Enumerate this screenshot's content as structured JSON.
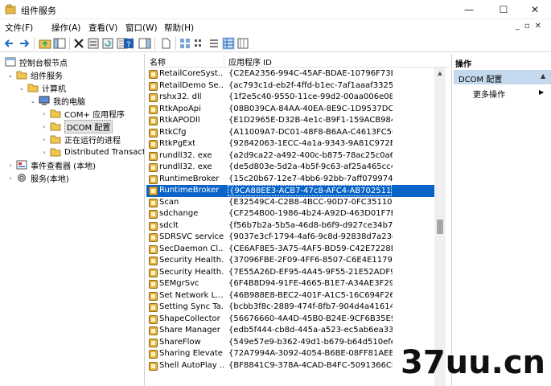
{
  "window": {
    "title": "组件服务"
  },
  "menu": [
    "文件(F)",
    "操作(A)",
    "查看(V)",
    "窗口(W)",
    "帮助(H)"
  ],
  "tree": {
    "items": [
      {
        "label": "控制台根节点",
        "expander": "",
        "icon": "console-root-icon"
      },
      {
        "label": "组件服务",
        "expander": "⌄",
        "icon": "folder-icon"
      },
      {
        "label": "计算机",
        "expander": "⌄",
        "icon": "folder-icon"
      },
      {
        "label": "我的电脑",
        "expander": "⌄",
        "icon": "computer-icon"
      },
      {
        "label": "COM+ 应用程序",
        "expander": "›",
        "icon": "folder-icon"
      },
      {
        "label": "DCOM 配置",
        "expander": "›",
        "icon": "folder-icon",
        "selected": true
      },
      {
        "label": "正在运行的进程",
        "expander": "›",
        "icon": "folder-icon"
      },
      {
        "label": "Distributed Transact",
        "expander": "›",
        "icon": "folder-icon"
      },
      {
        "label": "事件查看器 (本地)",
        "expander": "›",
        "icon": "event-viewer-icon"
      },
      {
        "label": "服务(本地)",
        "expander": "›",
        "icon": "services-icon"
      }
    ]
  },
  "list": {
    "columns": [
      "名称",
      "应用程序 ID"
    ],
    "rows": [
      {
        "name": "RetailCoreSyst...",
        "id": "{C2EA2356-994C-45AF-BDAE-10796F73B..."
      },
      {
        "name": "RetailDemo Se...",
        "id": "{ac793c1d-eb2f-4ffd-b1ec-7af1aaaf3325}"
      },
      {
        "name": "rshx32. dll",
        "id": "{1f2e5c40-9550-11ce-99d2-00aa006e086c}"
      },
      {
        "name": "RtkApoApi",
        "id": "{08B039CA-84AA-40EA-8E9C-1D9537DC4..."
      },
      {
        "name": "RtkAPODll",
        "id": "{E1D2965E-D32B-4e1c-B9F1-159ACB984..."
      },
      {
        "name": "RtkCfg",
        "id": "{A11009A7-DC01-48F8-B6AA-C4613FC5C..."
      },
      {
        "name": "RtkPgExt",
        "id": "{92842063-1ECC-4a1a-9343-9A81C972E..."
      },
      {
        "name": "rundll32. exe",
        "id": "{a2d9ca22-a492-400c-b875-78ac25c0a6f3}"
      },
      {
        "name": "rundll32. exe",
        "id": "{de5d803e-5d2a-4b5f-9c63-af25a465cc44}"
      },
      {
        "name": "RuntimeBroker",
        "id": "{15c20b67-12e7-4bb6-92bb-7aff0799740..."
      },
      {
        "name": "RuntimeBroker",
        "id": "{9CA88EE3-ACB7-47c8-AFC4-AB702511C...",
        "selected": true
      },
      {
        "name": "Scan",
        "id": "{E32549C4-C2B8-4BCC-90D7-0FC351109..."
      },
      {
        "name": "sdchange",
        "id": "{CF254B00-1986-4b24-A92D-463D01F7E..."
      },
      {
        "name": "sdclt",
        "id": "{f56b7b2a-5b5a-46d8-b6f9-d927ce34b7..."
      },
      {
        "name": "SDRSVC service",
        "id": "{9037e3cf-1794-4af6-9c8d-92838d7a23db}"
      },
      {
        "name": "SecDaemon Cl...",
        "id": "{CE6AF8E5-3A75-4AF5-BD59-C42E7228B..."
      },
      {
        "name": "Security Health...",
        "id": "{37096FBE-2F09-4FF6-8507-C6E4E117989..."
      },
      {
        "name": "Security Health...",
        "id": "{7E55A26D-EF95-4A45-9F55-21E52ADF98..."
      },
      {
        "name": "SEMgrSvc",
        "id": "{6F4B8D94-91FE-4665-B1E7-A34AE3F299..."
      },
      {
        "name": "Set Network L...",
        "id": "{46B988E8-BEC2-401F-A1C5-16C694F26..."
      },
      {
        "name": "Setting Sync Ta...",
        "id": "{bcbb3f8c-2889-474f-8fb7-904d4a416145}"
      },
      {
        "name": "ShapeCollector",
        "id": "{56676660-4A4D-45B0-B24E-9CF6B35E9..."
      },
      {
        "name": "Share Manager",
        "id": "{edb5f444-cb8d-445a-a523-ec5ab6ea33..."
      },
      {
        "name": "ShareFlow",
        "id": "{549e57e9-b362-49d1-b679-b64d510efe..."
      },
      {
        "name": "Sharing Elevate...",
        "id": "{72A7994A-3092-4054-B6BE-08FF81AEEF..."
      },
      {
        "name": "Shell AutoPlay ...",
        "id": "{BF8841C9-378A-4CAD-B4FC-5091366CB..."
      }
    ]
  },
  "actions": {
    "title": "操作",
    "section": "DCOM 配置",
    "more": "更多操作"
  },
  "watermark": "37uu.cn",
  "scroll": {
    "position_fraction": 0.48
  }
}
